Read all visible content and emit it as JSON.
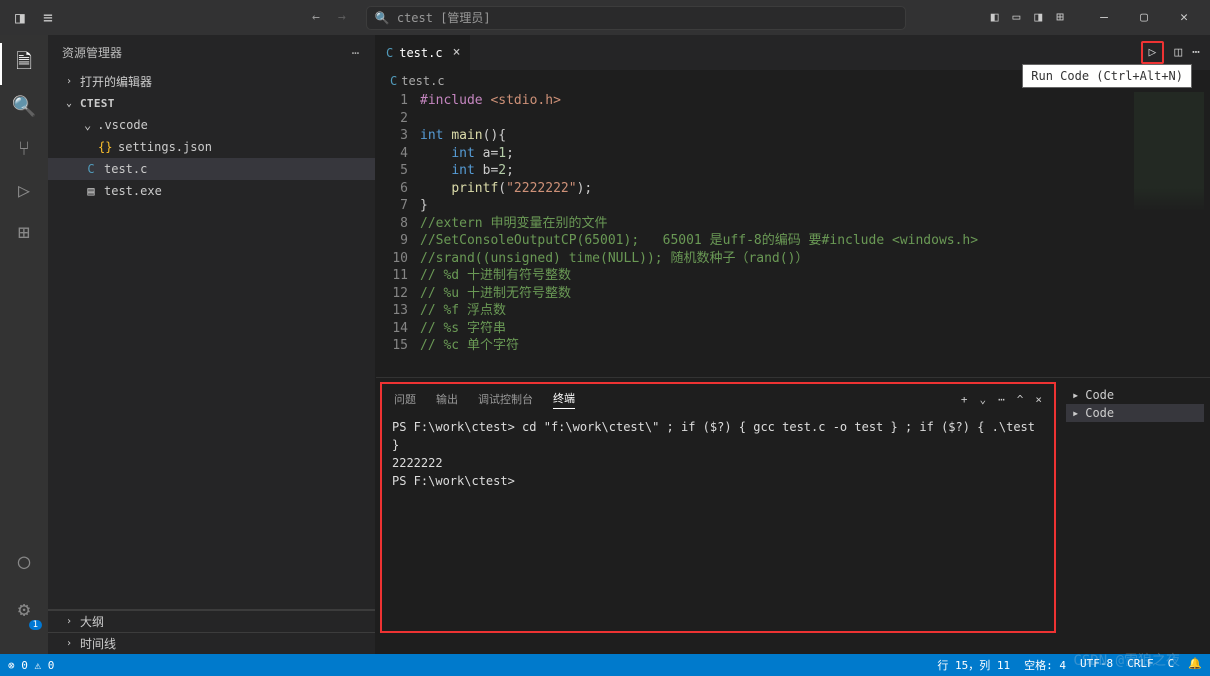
{
  "titlebar": {
    "search_text": "ctest [管理员]"
  },
  "tooltip": "Run Code (Ctrl+Alt+N)",
  "sidebar": {
    "title": "资源管理器",
    "open_editors": "打开的编辑器",
    "project": "CTEST",
    "folders": [
      ".vscode"
    ],
    "files": {
      "settings": "settings.json",
      "testc": "test.c",
      "testexe": "test.exe"
    },
    "outline": "大纲",
    "timeline": "时间线"
  },
  "tab": {
    "name": "test.c"
  },
  "breadcrumb": "test.c",
  "code": {
    "lines": [
      {
        "n": 1,
        "html": "<span class='inc'>#include</span> <span class='str'>&lt;stdio.h&gt;</span>"
      },
      {
        "n": 2,
        "html": ""
      },
      {
        "n": 3,
        "html": "<span class='kw'>int</span> <span class='fn'>main</span>(){"
      },
      {
        "n": 4,
        "html": "    <span class='kw'>int</span> a=<span class='num'>1</span>;"
      },
      {
        "n": 5,
        "html": "    <span class='kw'>int</span> b=<span class='num'>2</span>;"
      },
      {
        "n": 6,
        "html": "    <span class='fn'>printf</span>(<span class='str'>\"2222222\"</span>);"
      },
      {
        "n": 7,
        "html": "}"
      },
      {
        "n": 8,
        "html": "<span class='cmt'>//extern 申明变量在别的文件</span>"
      },
      {
        "n": 9,
        "html": "<span class='cmt'>//SetConsoleOutputCP(65001);   65001 是uff-8的编码 要#include &lt;windows.h&gt;</span>"
      },
      {
        "n": 10,
        "html": "<span class='cmt'>//srand((unsigned) time(NULL)); 随机数种子（rand()）</span>"
      },
      {
        "n": 11,
        "html": "<span class='cmt'>// %d 十进制有符号整数</span>"
      },
      {
        "n": 12,
        "html": "<span class='cmt'>// %u 十进制无符号整数</span>"
      },
      {
        "n": 13,
        "html": "<span class='cmt'>// %f 浮点数</span>"
      },
      {
        "n": 14,
        "html": "<span class='cmt'>// %s 字符串</span>"
      },
      {
        "n": 15,
        "html": "<span class='cmt'>// %c 单个字符</span>"
      }
    ]
  },
  "panel": {
    "tabs": {
      "problems": "问题",
      "output": "输出",
      "debug": "调试控制台",
      "terminal": "终端"
    },
    "terminal_lines": [
      "PS F:\\work\\ctest> cd \"f:\\work\\ctest\\\" ; if ($?) { gcc test.c -o test } ; if ($?) { .\\test }",
      "2222222",
      "PS F:\\work\\ctest>"
    ],
    "side": {
      "code1": "Code",
      "code2": "Code"
    }
  },
  "status": {
    "errors": "0",
    "warnings": "0",
    "pos": "行 15，列 11",
    "spaces": "空格: 4",
    "enc": "UTF-8",
    "eol": "CRLF",
    "lang": "C"
  },
  "watermark": "CSDN @雪狼之夜"
}
